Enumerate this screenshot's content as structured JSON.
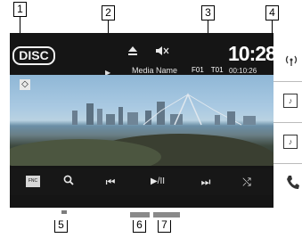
{
  "callouts": [
    "1",
    "2",
    "3",
    "4",
    "5",
    "6",
    "7"
  ],
  "screen": {
    "source_label": "DISC",
    "play_indicator": "▶",
    "eject_icon": "eject-icon",
    "mute_icon": "mute-icon",
    "media_name": "Media Name",
    "folder": "F01",
    "track": "T01",
    "clock": "10:28",
    "elapsed_time": "00:10:26",
    "aspect_indicator": "◇"
  },
  "controls": {
    "fnc_label": "FNC",
    "search": "Q",
    "prev": "⏮",
    "play_pause": "▶/II",
    "next": "⏭",
    "shuffle": "⤭"
  },
  "sidebar": {
    "icons": [
      "wireless-signal-icon",
      "music-note-icon",
      "music-note-small-icon",
      "phone-icon"
    ]
  },
  "colors": {
    "screen_bg": "#151515",
    "text": "#ffffff"
  }
}
